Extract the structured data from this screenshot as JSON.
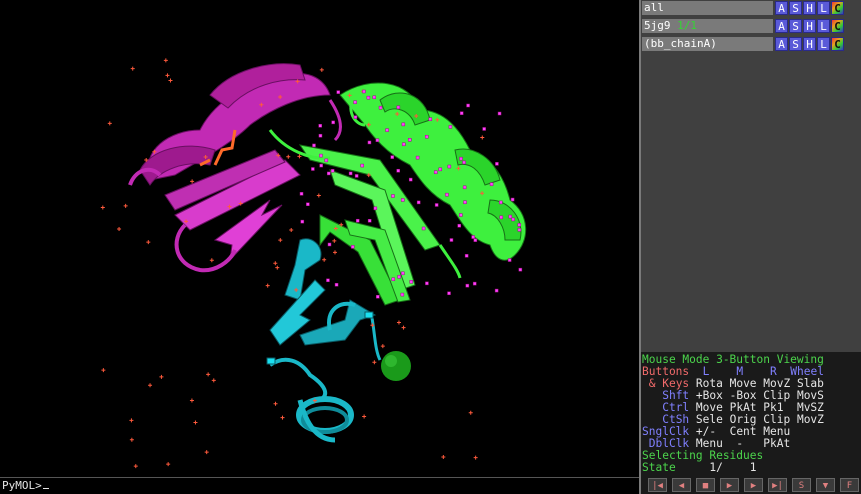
{
  "viewer": {
    "command_prompt": "PyMOL>"
  },
  "objects": [
    {
      "name": "all",
      "count": "",
      "buttons": [
        "A",
        "S",
        "H",
        "L",
        "C"
      ]
    },
    {
      "name": "5jg9",
      "count": "1/1",
      "buttons": [
        "A",
        "S",
        "H",
        "L",
        "C"
      ]
    },
    {
      "name": "(bb_chainA)",
      "count": "",
      "buttons": [
        "A",
        "S",
        "H",
        "L",
        "C"
      ]
    }
  ],
  "mouse_panel": {
    "mode_line": "Mouse Mode 3-Button Viewing",
    "buttons_label": "Buttons",
    "col_L": "L",
    "col_M": "M",
    "col_R": "R",
    "col_Wheel": "Wheel",
    "keys_label": "& Keys",
    "keys_vals": "Rota Move MovZ Slab",
    "shft_label": "Shft",
    "shft_vals": "+Box -Box Clip MovS",
    "ctrl_label": "Ctrl",
    "ctrl_vals": "Move PkAt Pk1  MvSZ",
    "ctsh_label": "CtSh",
    "ctsh_vals": "Sele Orig Clip MovZ",
    "sngl_label": "SnglClk",
    "sngl_vals": "+/-  Cent Menu",
    "dbl_label": "DblClk",
    "dbl_vals": "Menu  -   PkAt",
    "selecting": "Selecting Residues",
    "state_label": "State",
    "state_value": "1/    1"
  },
  "controls": [
    {
      "name": "rewind-button",
      "glyph": "|◀"
    },
    {
      "name": "step-back-button",
      "glyph": "◀"
    },
    {
      "name": "stop-button",
      "glyph": "■"
    },
    {
      "name": "play-button",
      "glyph": "▶"
    },
    {
      "name": "step-forward-button",
      "glyph": "▶"
    },
    {
      "name": "forward-end-button",
      "glyph": "▶|"
    },
    {
      "name": "scene-button",
      "glyph": "S"
    },
    {
      "name": "menu-button",
      "glyph": "▼"
    },
    {
      "name": "fullscreen-button",
      "glyph": "F"
    }
  ],
  "colors": {
    "helix_magenta": "#c22ab4",
    "helix_green": "#3ef03e",
    "chain_cyan": "#1ab8c8",
    "water": "#ff5a3c",
    "metal": "#1a9a1a"
  }
}
